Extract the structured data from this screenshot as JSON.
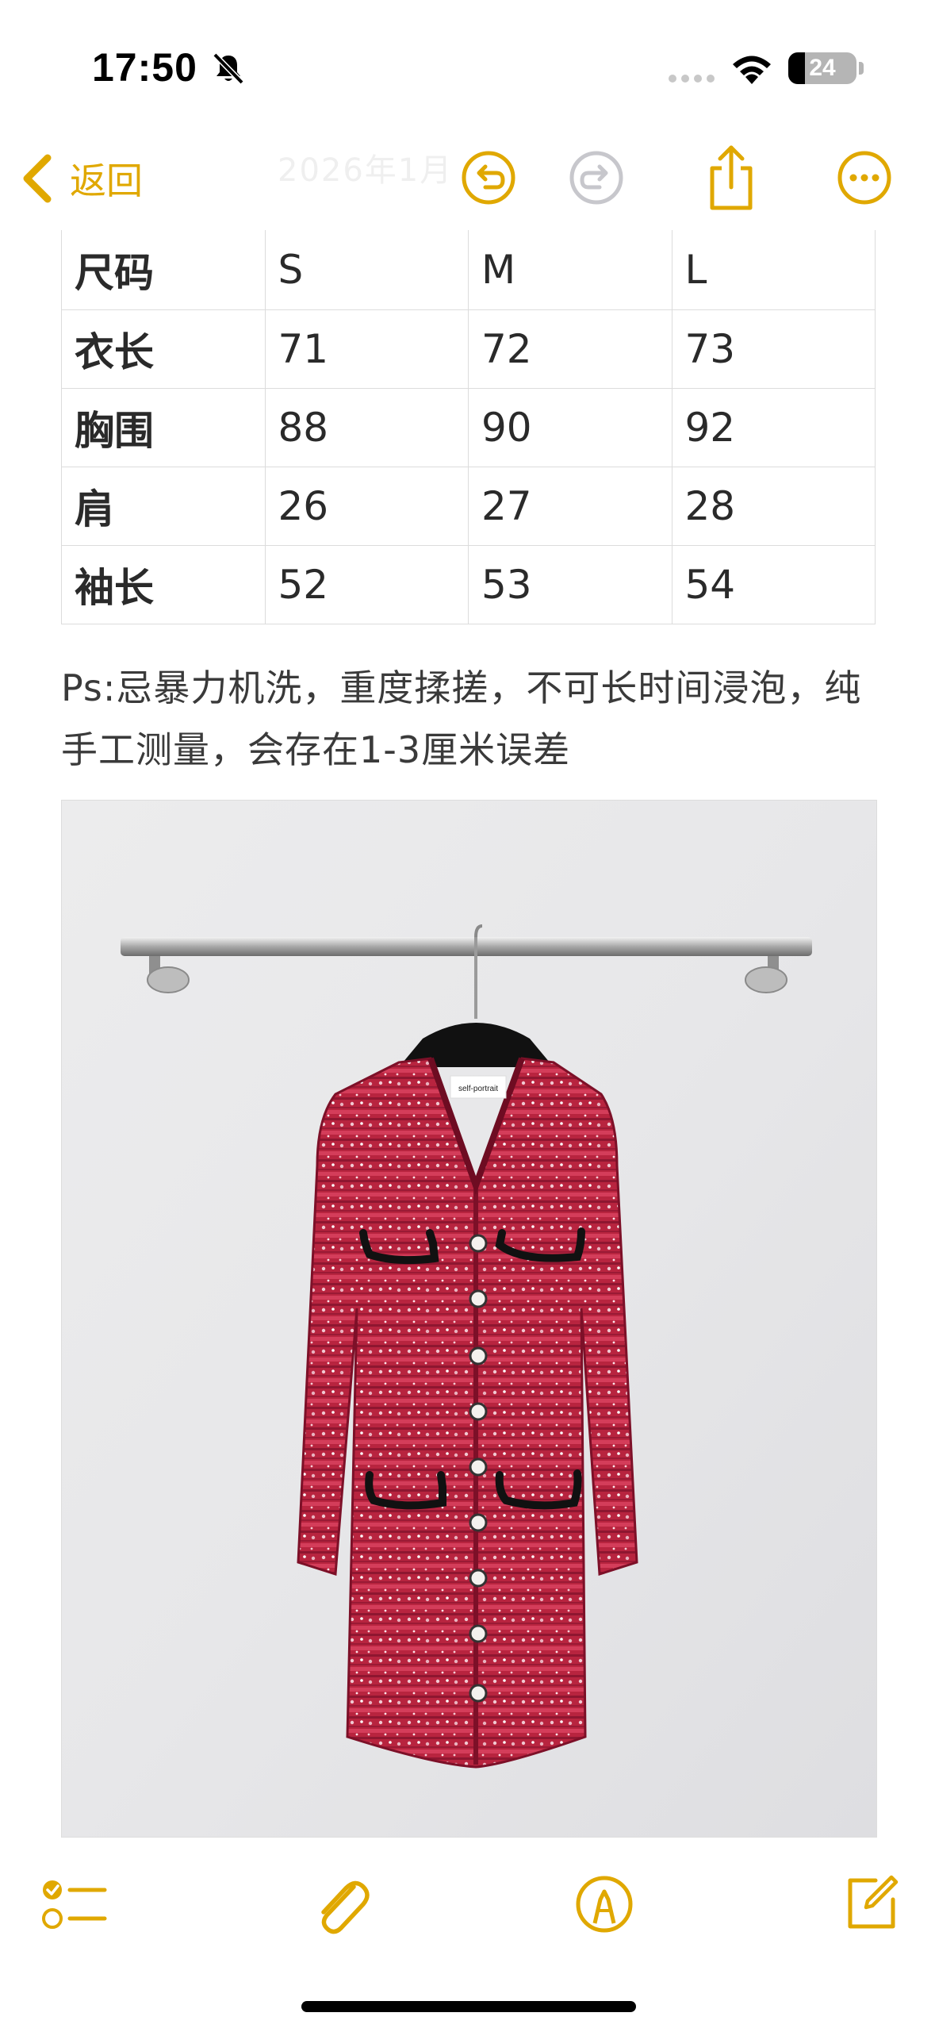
{
  "status_bar": {
    "time": "17:50",
    "battery_level": "24",
    "battery_fraction": 0.24,
    "icons": [
      "bell-slash-icon",
      "cellular-signal-icon",
      "wifi-icon",
      "battery-icon"
    ]
  },
  "nav": {
    "back_label": "返回",
    "date": "2026年1月",
    "icons": [
      "chevron-left-icon",
      "undo-icon",
      "redo-icon",
      "share-icon",
      "more-icon"
    ]
  },
  "size_table": {
    "rows": [
      [
        "尺码",
        "S",
        "M",
        "L"
      ],
      [
        "衣长",
        "71",
        "72",
        "73"
      ],
      [
        "胸围",
        "88",
        "90",
        "92"
      ],
      [
        "肩",
        "26",
        "27",
        "28"
      ],
      [
        "袖长",
        "52",
        "53",
        "54"
      ]
    ]
  },
  "note": {
    "text": "Ps:忌暴力机洗，重度揉搓，不可长时间浸泡，纯手工测量，会存在1-3厘米误差"
  },
  "photo": {
    "label": "self-portrait"
  },
  "toolbar": {
    "icons": [
      "checklist-icon",
      "paperclip-icon",
      "markup-pen-icon",
      "compose-icon"
    ]
  },
  "colors": {
    "accent": "#e0a800",
    "disabled": "#c7c7cc",
    "dress": "#b5223e"
  }
}
